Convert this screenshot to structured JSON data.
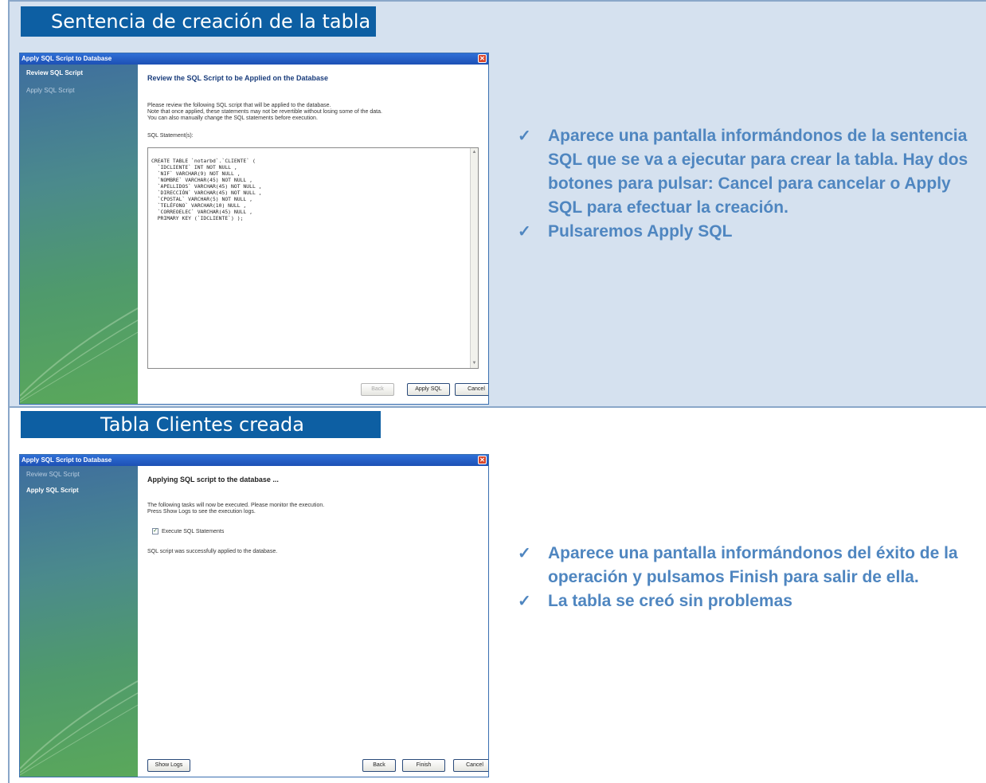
{
  "section1": {
    "banner": "Sentencia de creación de la tabla",
    "dialog": {
      "title": "Apply SQL Script to Database",
      "side_items": [
        "Review SQL Script",
        "Apply SQL Script"
      ],
      "heading": "Review the SQL Script to be Applied on the Database",
      "intro_lines": [
        "Please review the following SQL script that will be applied to the database.",
        "Note that once applied, these statements may not be revertible without losing some of the data.",
        "You can also manually change the SQL statements before execution."
      ],
      "sql_label": "SQL Statement(s):",
      "sql_lines": [
        "CREATE TABLE `notarbd`.`CLIENTE` (",
        "  `IDCLIENTE` INT NOT NULL ,",
        "  `NIF` VARCHAR(9) NOT NULL ,",
        "  `NOMBRE` VARCHAR(45) NOT NULL ,",
        "  `APELLIDOS` VARCHAR(45) NOT NULL ,",
        "  `DIRECCIÓN` VARCHAR(45) NOT NULL ,",
        "  `CPOSTAL` VARCHAR(5) NOT NULL ,",
        "  `TELÉFONO` VARCHAR(10) NULL ,",
        "  `CORREOELEC` VARCHAR(45) NULL ,",
        "  PRIMARY KEY (`IDCLIENTE`) );"
      ],
      "buttons": {
        "back": "Back",
        "apply": "Apply SQL",
        "cancel": "Cancel"
      }
    },
    "bullets": [
      "Aparece una pantalla informándonos de la sentencia SQL que se va a ejecutar para crear la tabla. Hay dos botones para pulsar: Cancel para cancelar o Apply SQL para efectuar la creación.",
      "Pulsaremos Apply SQL"
    ]
  },
  "section2": {
    "banner": "Tabla Clientes creada",
    "dialog": {
      "title": "Apply SQL Script to Database",
      "side_items": [
        "Review SQL Script",
        "Apply SQL Script"
      ],
      "heading": "Applying SQL script to the database ...",
      "intro_lines": [
        "The following tasks will now be executed. Please monitor the execution.",
        "Press Show Logs to see the execution logs."
      ],
      "task_label": "Execute SQL Statements",
      "success_text": "SQL script was successfully applied to the database.",
      "buttons": {
        "show_logs": "Show Logs",
        "back": "Back",
        "finish": "Finish",
        "cancel": "Cancel"
      }
    },
    "bullets": [
      "Aparece una pantalla informándonos del éxito de la operación y pulsamos Finish para salir de ella.",
      "La tabla se creó sin problemas"
    ]
  },
  "icons": {
    "bullet": "checkmark-icon",
    "close": "close-icon",
    "checkbox": "checkbox-checked-icon"
  },
  "colors": {
    "banner": "#0d5fa3",
    "bullet_text": "#4f86c0",
    "panel": "#d5e1ef"
  }
}
